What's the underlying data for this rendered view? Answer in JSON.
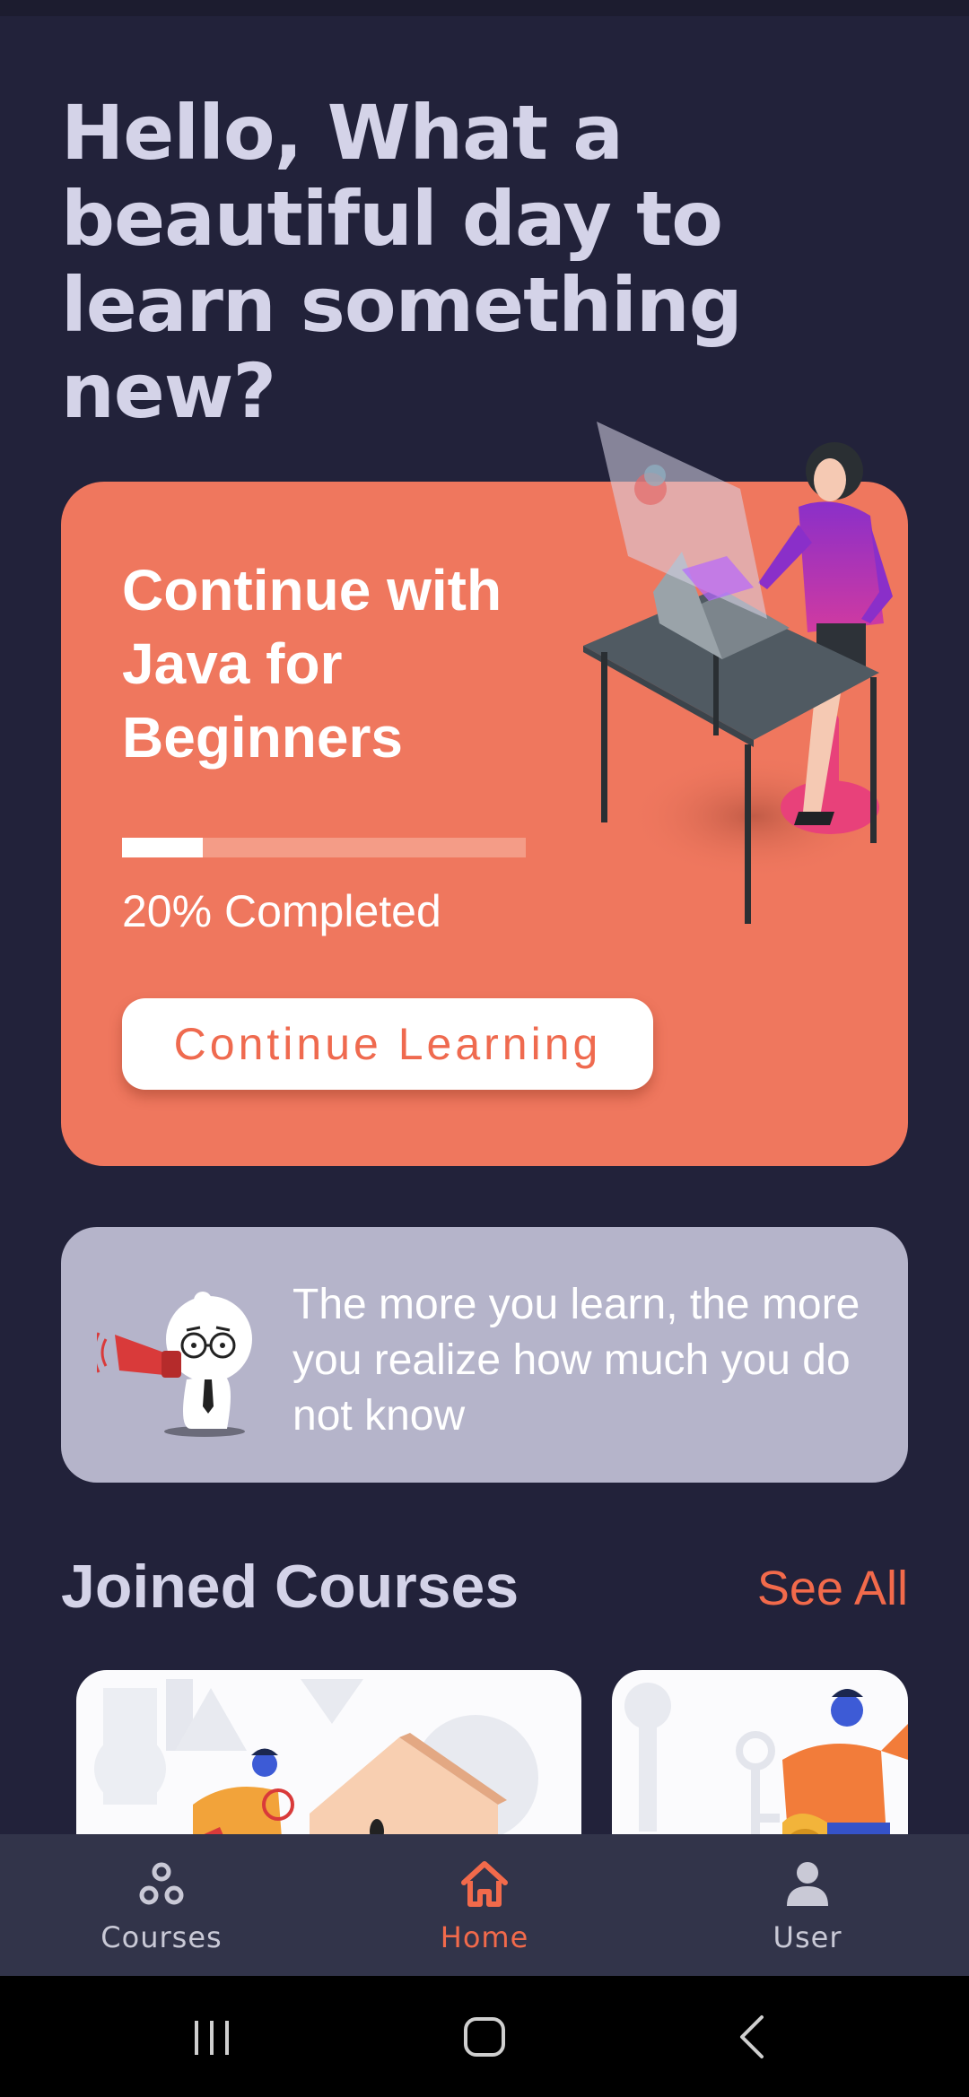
{
  "greeting": "Hello, What a beautiful day to learn something new?",
  "continue_card": {
    "title": "Continue with Java for Beginners",
    "progress_fraction": 0.2,
    "progress_text": "20% Completed",
    "button_label": "Continue Learning",
    "illustration_icon": "woman-at-desk-laptop-illustration"
  },
  "quote": {
    "icon": "megaphone-mascot-icon",
    "text": "The more you learn, the more you realize how much you do not know"
  },
  "joined_courses": {
    "title": "Joined Courses",
    "see_all": "See All"
  },
  "bottom_nav": {
    "items": [
      {
        "label": "Courses",
        "icon": "courses-icon",
        "active": false
      },
      {
        "label": "Home",
        "icon": "home-icon",
        "active": true
      },
      {
        "label": "User",
        "icon": "user-icon",
        "active": false
      }
    ]
  },
  "colors": {
    "background": "#22223a",
    "accent": "#f26a4b",
    "card_orange": "#ef775e",
    "quote_card": "#b5b4ca",
    "nav_inactive": "#c9c9d6"
  }
}
